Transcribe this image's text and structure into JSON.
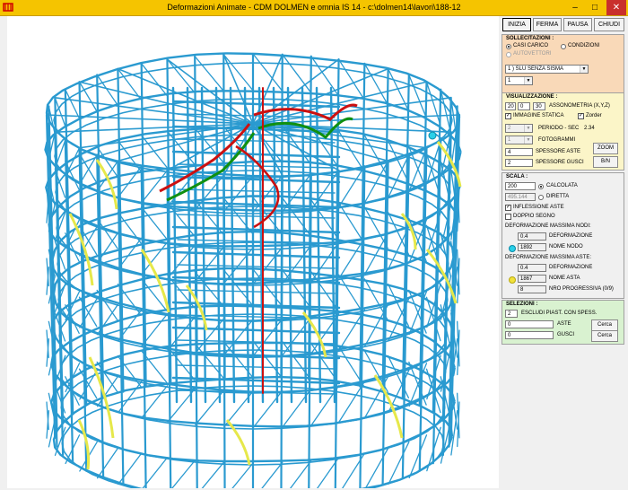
{
  "window": {
    "title": "Deformazioni Animate - CDM DOLMEN e omnia IS 14 - c:\\dolmen14\\lavori\\188-12",
    "minimize": "–",
    "maximize": "□",
    "close": "✕"
  },
  "toolbar": {
    "inizia": "INIZIA",
    "ferma": "FERMA",
    "pausa": "PAUSA",
    "chiudi": "CHIUDI"
  },
  "sollecitazioni": {
    "title": "SOLLECITAZIONI :",
    "casi_carico": "CASI CARICO",
    "condizioni": "CONDIZIONI",
    "autovettori": "AUTOVETTORI",
    "combo_value": "1 ) SLU SENZA SISMA",
    "sub_value": "1"
  },
  "visualizzazione": {
    "title": "VISUALIZZAZIONE :",
    "axon_x": "20",
    "axon_y": "0",
    "axon_z": "30",
    "axon_label": "ASSONOMETRIA (X,Y,Z)",
    "immagine_statica": "IMMAGINE STATICA",
    "zorder": "Zorder",
    "periodo_value": "2",
    "periodo_label": "PERIODO - SEC",
    "periodo_sec": "2.34",
    "fotogrammi_value": "1",
    "fotogrammi_label": "FOTOGRAMMI",
    "zoom": "ZOOM",
    "spessore_aste_value": "4",
    "spessore_aste_label": "SPESSORE ASTE",
    "spessore_gusci_value": "2",
    "spessore_gusci_label": "SPESSORE GUSCI",
    "bn": "B/N"
  },
  "scala": {
    "title": "SCALA :",
    "calcolata_value": "200",
    "calcolata_label": "CALCOLATA",
    "diretta_value": "495.144",
    "diretta_label": "DIRETTA",
    "inflessione": "INFLESSIONE ASTE",
    "doppio": "DOPPIO SEGNO",
    "def_nodi_label": "DEFORMAZIONE MASSIMA NODI:",
    "def_nodi_value": "0.4",
    "deformazione1": "DEFORMAZIONE",
    "nome_nodo_value": "1892",
    "nome_nodo_label": "NOME NODO",
    "def_aste_label": "DEFORMAZIONE MASSIMA ASTE:",
    "def_aste_value": "0.4",
    "deformazione2": "DEFORMAZIONE",
    "nome_asta_value": "1867",
    "nome_asta_label": "NOME ASTA",
    "nro_value": "8",
    "nro_label": "NRO PROGRESSIVA (0/9)"
  },
  "selezioni": {
    "title": "SELEZIONI :",
    "escludi_value": "2",
    "escludi_label": "ESCLUDI PIAST. CON SPESS.",
    "aste_value": "0",
    "aste_label": "ASTE",
    "gusci_value": "0",
    "gusci_label": "GUSCI",
    "cerca1": "Cerca",
    "cerca2": "Cerca"
  },
  "colors": {
    "titlebar": "#f5c400",
    "structure": "#2a9ad0",
    "deformed_red": "#cc1010",
    "deformed_green": "#109010",
    "shell_yellow": "#e6e84a",
    "sollecitazioni_bg": "#f9d9b8",
    "visualizzazione_bg": "#fbf5c8",
    "scala_bg": "#f0f0f0",
    "selezioni_bg": "#d9f2d0"
  }
}
